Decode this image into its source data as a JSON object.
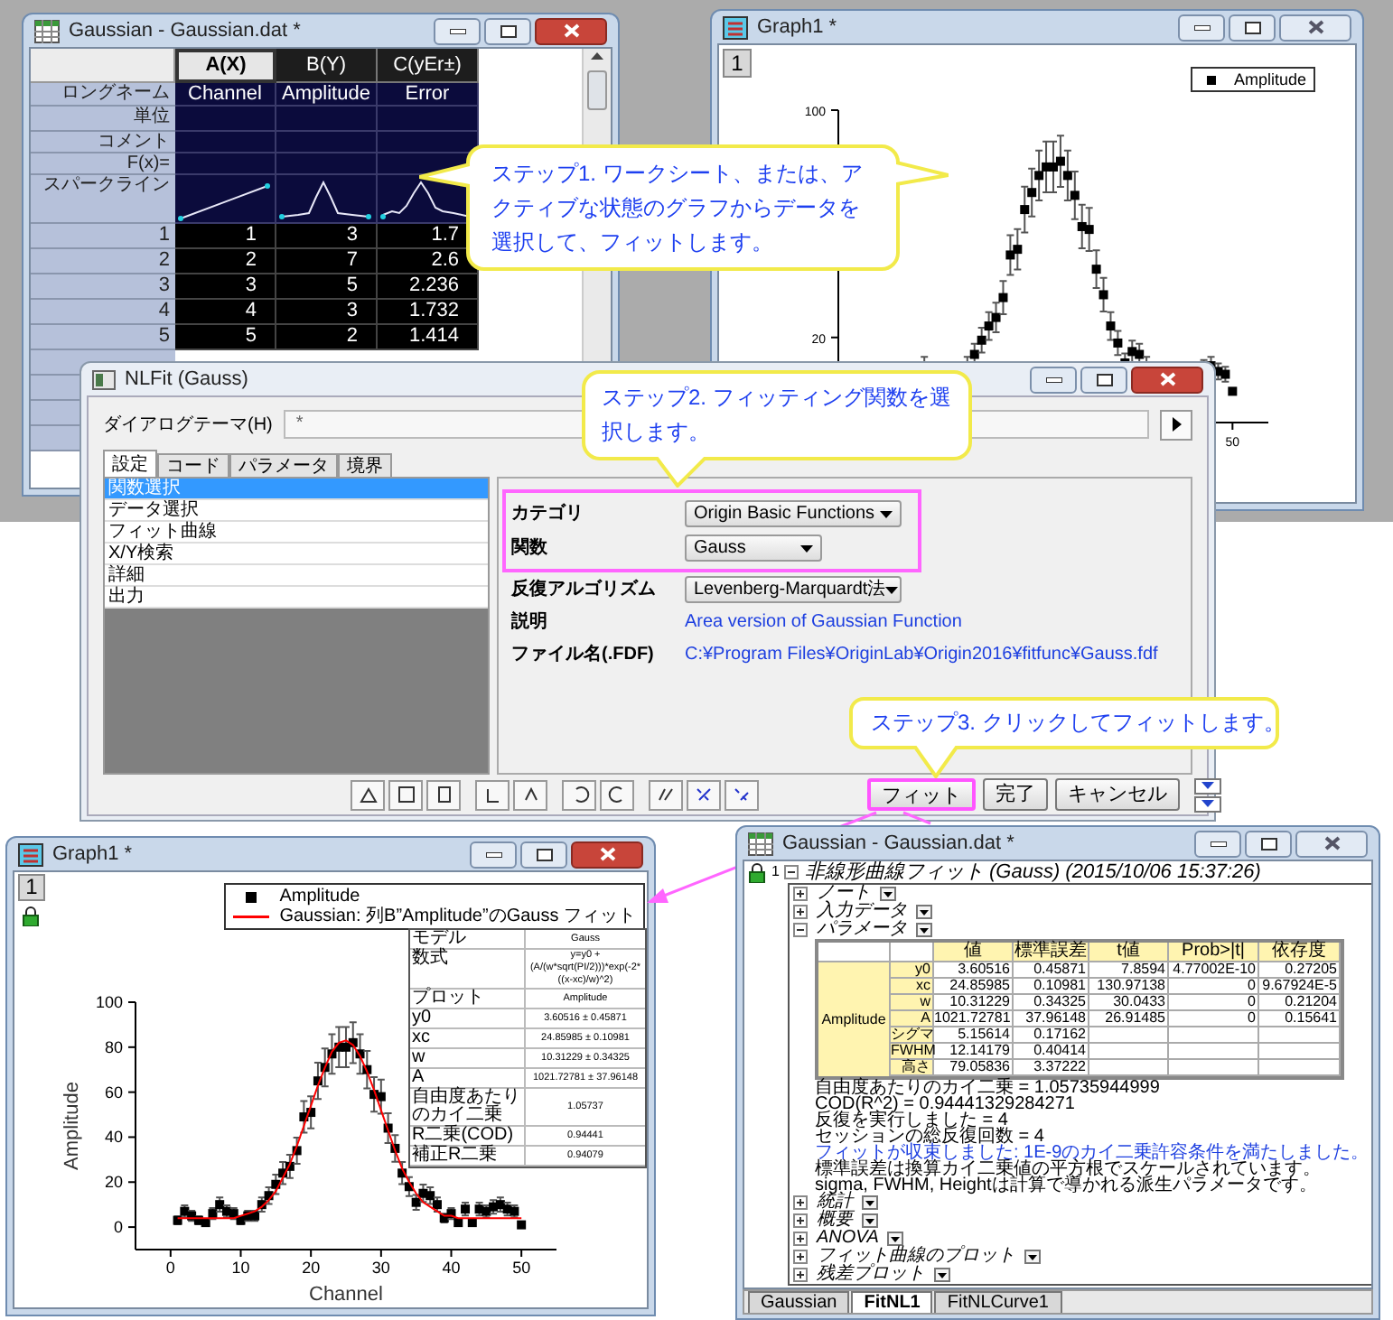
{
  "worksheet": {
    "title": "Gaussian - Gaussian.dat *",
    "active": true,
    "columns": [
      {
        "label": "A(X)",
        "selected": true,
        "long_name": "Channel"
      },
      {
        "label": "B(Y)",
        "selected": false,
        "long_name": "Amplitude"
      },
      {
        "label": "C(yEr±)",
        "selected": false,
        "long_name": "Error"
      }
    ],
    "label_rows": [
      {
        "label": "ロングネーム",
        "kind": "long_name"
      },
      {
        "label": "単位",
        "kind": "empty"
      },
      {
        "label": "コメント",
        "kind": "empty"
      },
      {
        "label": "F(x)=",
        "kind": "empty"
      },
      {
        "label": "スパークライン",
        "kind": "sparkline"
      }
    ],
    "rows": [
      {
        "index": "1",
        "cells": [
          "1",
          "3",
          "1.7"
        ]
      },
      {
        "index": "2",
        "cells": [
          "2",
          "7",
          "2.6"
        ]
      },
      {
        "index": "3",
        "cells": [
          "3",
          "5",
          "2.236"
        ]
      },
      {
        "index": "4",
        "cells": [
          "4",
          "3",
          "1.732"
        ]
      },
      {
        "index": "5",
        "cells": [
          "5",
          "2",
          "1.414"
        ]
      }
    ]
  },
  "graph_top": {
    "title": "Graph1 *",
    "active": false,
    "layer": "1",
    "legend": "Amplitude",
    "y_tick_labels": [
      "100",
      "20"
    ],
    "x_tick_labels": [
      "50"
    ]
  },
  "nlfit": {
    "title": "NLFit (Gauss)",
    "active": true,
    "theme_label": "ダイアログテーマ(H)",
    "theme_value": "*",
    "tabs": [
      {
        "label": "設定",
        "selected": true
      },
      {
        "label": "コード",
        "selected": false
      },
      {
        "label": "パラメータ",
        "selected": false
      },
      {
        "label": "境界",
        "selected": false
      }
    ],
    "pages": [
      {
        "label": "関数選択",
        "selected": true
      },
      {
        "label": "データ選択",
        "selected": false
      },
      {
        "label": "フィット曲線",
        "selected": false
      },
      {
        "label": "X/Y検索",
        "selected": false
      },
      {
        "label": "詳細",
        "selected": false
      },
      {
        "label": "出力",
        "selected": false
      }
    ],
    "fields": [
      {
        "label": "カテゴリ",
        "kind": "dropdown",
        "value": "Origin Basic Functions",
        "highlighted": true
      },
      {
        "label": "関数",
        "kind": "dropdown",
        "value": "Gauss",
        "highlighted": true
      },
      {
        "label": "反復アルゴリズム",
        "kind": "dropdown",
        "value": "Levenberg-Marquardt法",
        "highlighted": false
      },
      {
        "label": "説明",
        "kind": "link",
        "value": "Area version of Gaussian Function",
        "highlighted": false
      },
      {
        "label": "ファイル名(.FDF)",
        "kind": "link",
        "value": "C:¥Program Files¥OriginLab¥Origin2016¥fitfunc¥Gauss.fdf",
        "highlighted": false
      }
    ],
    "buttons": [
      {
        "label": "フィット",
        "highlighted": true
      },
      {
        "label": "完了",
        "highlighted": false
      },
      {
        "label": "キャンセル",
        "highlighted": false
      }
    ]
  },
  "callouts": [
    {
      "text": "ステップ1. ワークシート、または、アクティブな状態のグラフからデータを選択して、フィットします。"
    },
    {
      "text": "ステップ2. フィッティング関数を選択します。"
    },
    {
      "text": "ステップ3. クリックしてフィットします。"
    }
  ],
  "graph_bottom": {
    "title": "Graph1 *",
    "active": true,
    "layer": "1",
    "fit_table": [
      [
        "モデル",
        "Gauss"
      ],
      [
        "数式",
        "y=y0 + (A/(w*sqrt(PI/2)))*exp(-2*((x-xc)/w)^2)"
      ],
      [
        "プロット",
        "Amplitude"
      ],
      [
        "y0",
        "3.60516 ± 0.45871"
      ],
      [
        "xc",
        "24.85985 ± 0.10981"
      ],
      [
        "w",
        "10.31229 ± 0.34325"
      ],
      [
        "A",
        "1021.72781 ± 37.96148"
      ],
      [
        "自由度あたりのカイ二乗",
        "1.05737"
      ],
      [
        "R二乗(COD)",
        "0.94441"
      ],
      [
        "補正R二乗",
        "0.94079"
      ]
    ],
    "chart_data": {
      "type": "scatter",
      "xlabel": "Channel",
      "ylabel": "Amplitude",
      "x": [
        1,
        2,
        3,
        4,
        5,
        6,
        7,
        8,
        9,
        10,
        11,
        12,
        13,
        14,
        15,
        16,
        17,
        18,
        19,
        20,
        21,
        22,
        23,
        24,
        25,
        26,
        27,
        28,
        29,
        30,
        31,
        32,
        33,
        34,
        35,
        36,
        37,
        38,
        39,
        40,
        41,
        42,
        43,
        44,
        45,
        46,
        47,
        48,
        49,
        50
      ],
      "series": [
        {
          "name": "Amplitude",
          "color": "#000000",
          "values": [
            3,
            7,
            5,
            3,
            2,
            6,
            10,
            7,
            6,
            3,
            5,
            5,
            10,
            14,
            19,
            24,
            27,
            34,
            49,
            51,
            65,
            71,
            77,
            80,
            80,
            82,
            77,
            70,
            59,
            58,
            44,
            35,
            24,
            18,
            11,
            15,
            14,
            10,
            4,
            6,
            2,
            8,
            2,
            8,
            7,
            9,
            10,
            8,
            7,
            1
          ],
          "errors": [
            1.73,
            2.65,
            2.24,
            1.73,
            null,
            2.45,
            3.16,
            2.65,
            2.45,
            1.73,
            2.24,
            2.24,
            3.16,
            3.74,
            4.36,
            4.9,
            5.2,
            5.83,
            7,
            7.14,
            8.06,
            8.43,
            8.77,
            8.94,
            8.94,
            9.06,
            8.77,
            8.37,
            7.68,
            7.62,
            6.63,
            5.92,
            4.9,
            4.24,
            3.32,
            3.87,
            3.74,
            3.16,
            2,
            2.45,
            1.41,
            2.83,
            null,
            2.83,
            2.65,
            3,
            3.16,
            2.83,
            2.65,
            null
          ]
        },
        {
          "name": "Gaussian: 列B”Amplitude”のGauss フィット",
          "type": "line",
          "color": "#ff0000",
          "values": [
            4,
            4,
            4,
            4,
            4,
            4,
            4,
            4,
            4,
            5,
            6,
            7,
            9,
            12,
            16,
            22,
            28,
            36,
            45,
            54,
            63,
            71,
            78,
            82,
            83,
            81,
            76,
            69,
            61,
            52,
            43,
            34,
            26,
            20,
            15,
            11,
            9,
            7,
            5,
            5,
            4,
            4,
            4,
            4,
            4,
            4,
            4,
            4,
            4,
            4
          ]
        }
      ],
      "legend": "upper right",
      "xlim": [
        -5,
        55
      ],
      "ylim": [
        -10,
        100
      ],
      "xticks": [
        0,
        10,
        20,
        30,
        40,
        50
      ],
      "yticks": [
        0,
        20,
        40,
        60,
        80,
        100
      ]
    }
  },
  "report": {
    "title": "Gaussian - Gaussian.dat *",
    "active": false,
    "index": "1",
    "heading": "非線形曲線フィット (Gauss) (2015/10/06 15:37:26)",
    "expanded": true,
    "children": [
      {
        "label": "ノート",
        "expanded": false
      },
      {
        "label": "入力データ",
        "expanded": false
      },
      {
        "label": "パラメータ",
        "expanded": true,
        "table": {
          "group": "Amplitude",
          "columns": [
            "値",
            "標準誤差",
            "t値",
            "Prob>|t|",
            "依存度"
          ],
          "rows": [
            {
              "label": "y0",
              "cells": [
                "3.60516",
                "0.45871",
                "7.8594",
                "4.77002E-10",
                "0.27205"
              ]
            },
            {
              "label": "xc",
              "cells": [
                "24.85985",
                "0.10981",
                "130.97138",
                "0",
                "9.67924E-5"
              ]
            },
            {
              "label": "w",
              "cells": [
                "10.31229",
                "0.34325",
                "30.0433",
                "0",
                "0.21204"
              ]
            },
            {
              "label": "A",
              "cells": [
                "1021.72781",
                "37.96148",
                "26.91485",
                "0",
                "0.15641"
              ]
            },
            {
              "label": "シグマ",
              "cells": [
                "5.15614",
                "0.17162"
              ]
            },
            {
              "label": "FWHM",
              "cells": [
                "12.14179",
                "0.40414"
              ]
            },
            {
              "label": "高さ",
              "cells": [
                "79.05836",
                "3.37222"
              ]
            }
          ]
        },
        "notes": [
          {
            "kind": "info",
            "text": "自由度あたりのカイ二乗 = 1.05735944999"
          },
          {
            "kind": "info",
            "text": "COD(R^2) = 0.94441329284271"
          },
          {
            "kind": "info",
            "text": "反復を実行しました = 4"
          },
          {
            "kind": "info",
            "text": "セッションの総反復回数 = 4"
          },
          {
            "kind": "message",
            "text": "フィットが収束しました: 1E-9のカイ二乗許容条件を満たしました。"
          },
          {
            "kind": "info",
            "text": "標準誤差は換算カイ二乗値の平方根でスケールされています。"
          },
          {
            "kind": "info",
            "text": "sigma, FWHM, Heightは計算で導かれる派生パラメータです。"
          }
        ]
      },
      {
        "label": "統計",
        "expanded": false
      },
      {
        "label": "概要",
        "expanded": false
      },
      {
        "label": "ANOVA",
        "expanded": false
      },
      {
        "label": "フィット曲線のプロット",
        "expanded": false
      },
      {
        "label": "残差プロット",
        "expanded": false
      }
    ],
    "sheet_tabs": [
      {
        "label": "Gaussian",
        "selected": false
      },
      {
        "label": "FitNL1",
        "selected": true
      },
      {
        "label": "FitNLCurve1",
        "selected": false
      }
    ]
  }
}
